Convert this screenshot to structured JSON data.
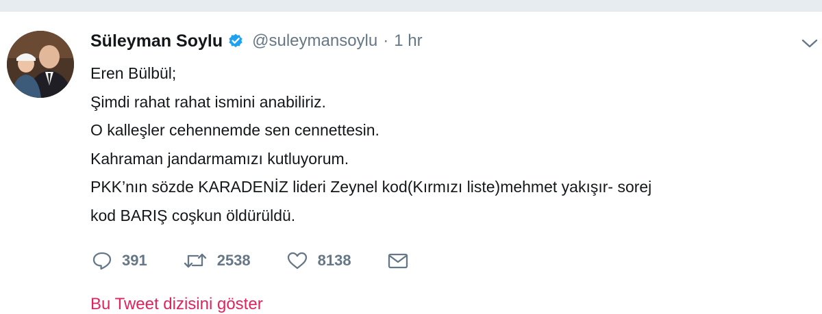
{
  "tweet": {
    "author_name": "Süleyman Soylu",
    "handle": "@suleymansoylu",
    "separator": "·",
    "time": "1 hr",
    "verified_icon": "verified-badge-icon",
    "caret_icon": "chevron-down-icon",
    "text_lines": [
      "Eren Bülbül;",
      "Şimdi rahat rahat ismini anabiliriz.",
      "O kalleşler cehennemde sen cennettesin.",
      "Kahraman jandarmamızı kutluyorum.",
      "PKK’nın sözde KARADENİZ lideri Zeynel kod(Kırmızı liste)mehmet yakışır- sorej",
      "kod BARIŞ coşkun öldürüldü."
    ],
    "actions": {
      "reply": {
        "icon": "reply-icon",
        "count": "391"
      },
      "retweet": {
        "icon": "retweet-icon",
        "count": "2538"
      },
      "like": {
        "icon": "heart-icon",
        "count": "8138"
      },
      "message": {
        "icon": "envelope-icon"
      }
    },
    "thread_link": "Bu Tweet dizisini göster"
  },
  "colors": {
    "accent": "#1da1f2",
    "secondary_text": "#657786",
    "link_red": "#e0245e"
  }
}
